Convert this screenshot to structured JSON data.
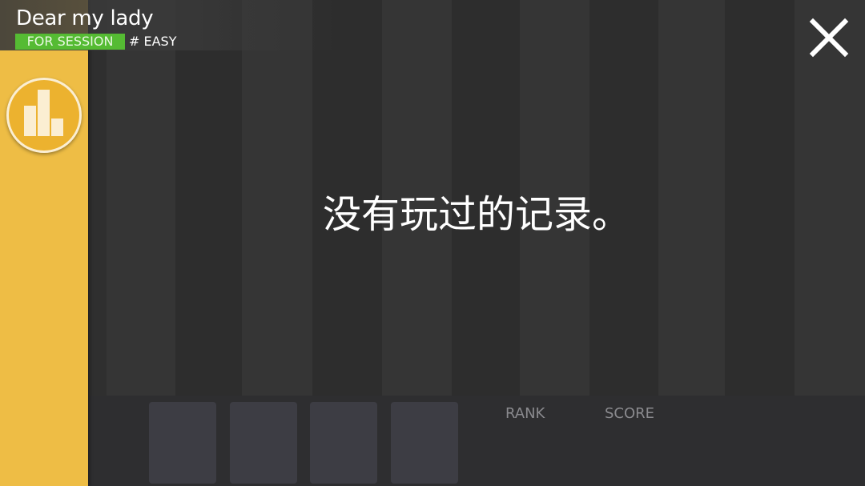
{
  "header": {
    "song_title": "Dear my lady",
    "session_badge": "FOR SESSION",
    "difficulty": "# EASY"
  },
  "main": {
    "empty_message": "没有玩过的记录。"
  },
  "bottom_panel": {
    "rank_label": "RANK",
    "score_label": "SCORE"
  },
  "colors": {
    "sidebar": "#eebd45",
    "badge": "#55bb33",
    "lane_light": "#353535",
    "lane_dark": "#2c2c2c",
    "bottom_slot": "#3d3d44"
  },
  "icons": {
    "stats": "bar-chart-icon",
    "close": "close-icon"
  }
}
